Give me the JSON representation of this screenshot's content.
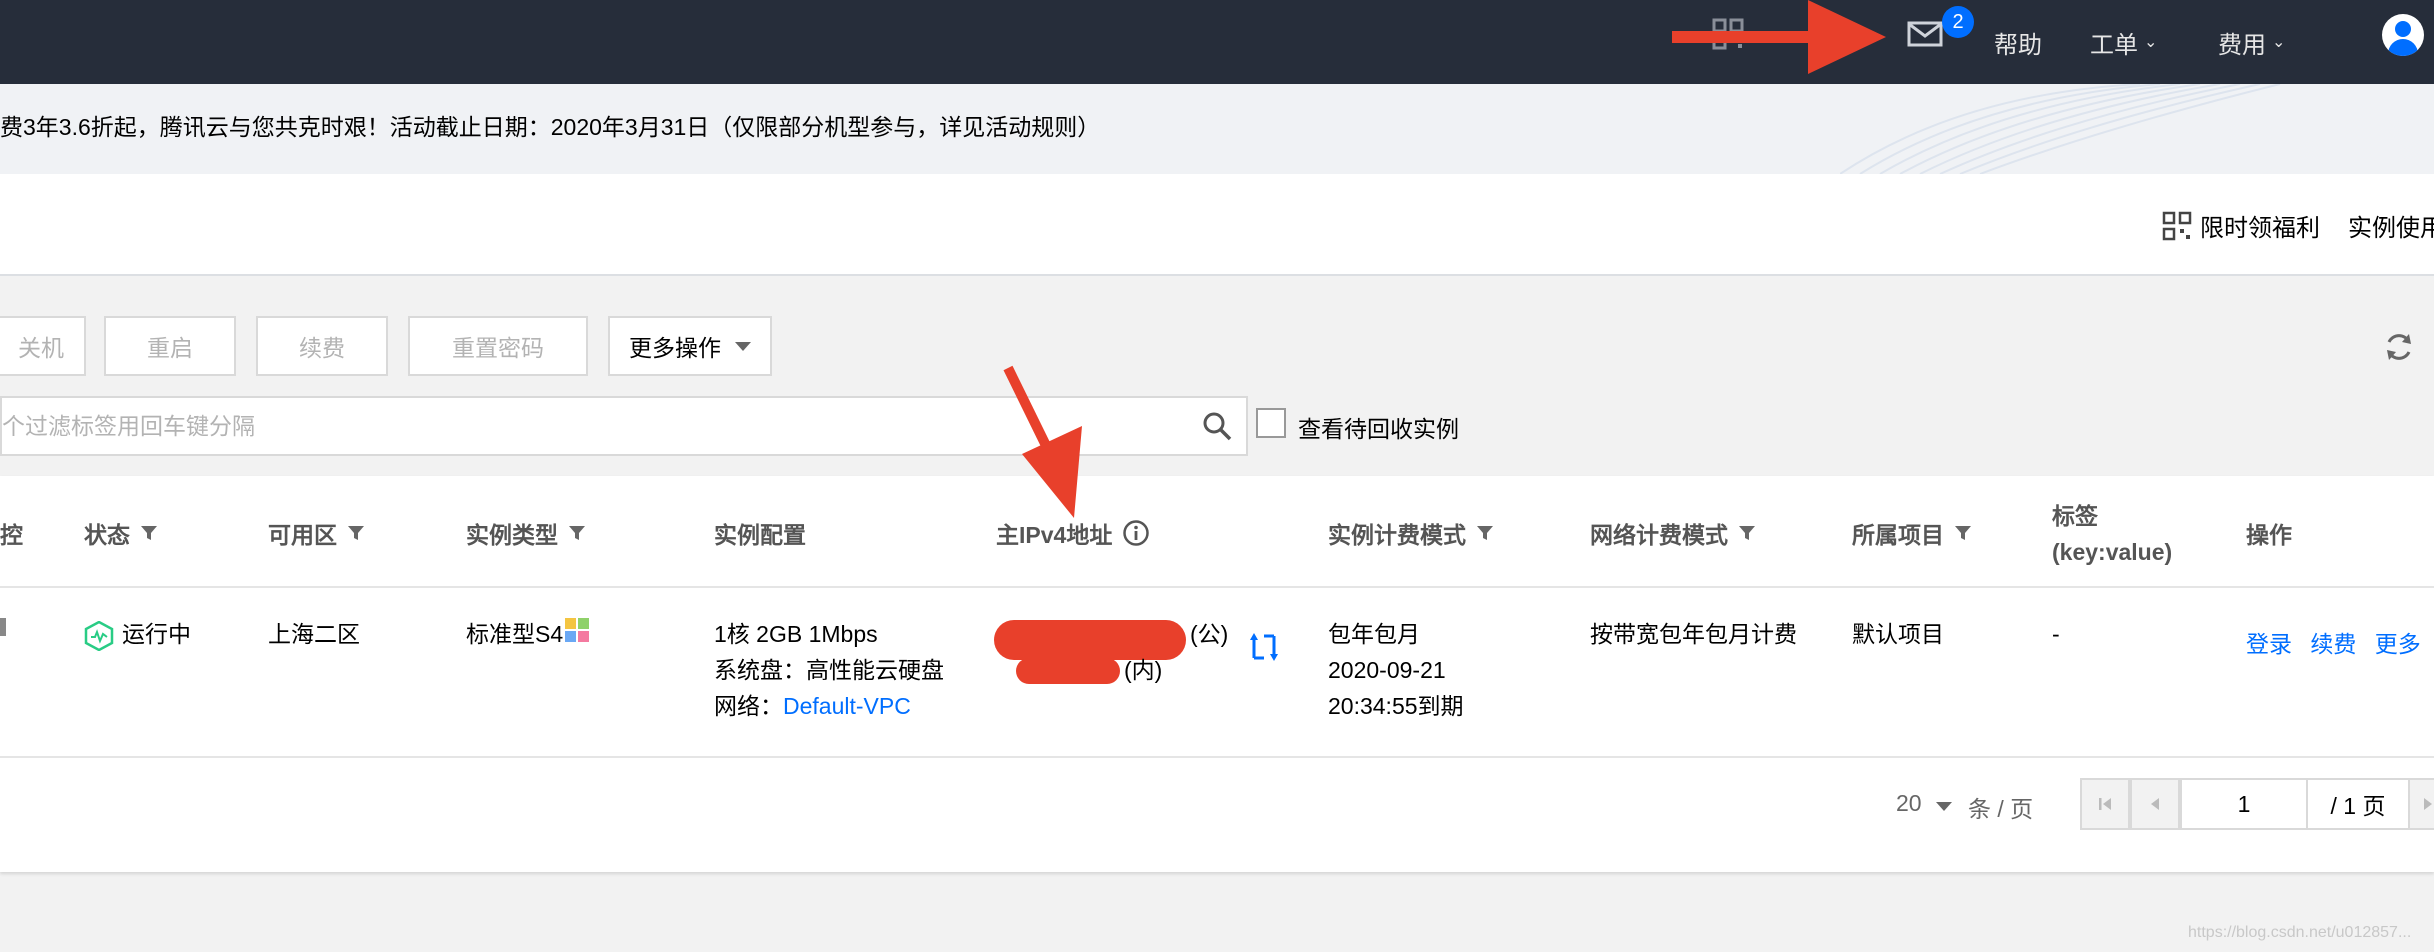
{
  "topbar": {
    "help_label": "帮助",
    "ticket_label": "工单",
    "fee_label": "费用",
    "mail_badge": "2"
  },
  "banner": {
    "text": "费3年3.6折起，腾讯云与您共克时艰！活动截止日期：2020年3月31日（仅限部分机型参与，详见活动规则）"
  },
  "header": {
    "benefit_label": "限时领福利",
    "usage_label": "实例使用"
  },
  "toolbar": {
    "shutdown_label": "关机",
    "restart_label": "重启",
    "renew_label": "续费",
    "reset_password_label": "重置密码",
    "more_actions_label": "更多操作",
    "search_placeholder": "个过滤标签用回车键分隔",
    "recycle_label": "查看待回收实例"
  },
  "table": {
    "columns": {
      "monitor": "控",
      "status": "状态",
      "zone": "可用区",
      "instance_type": "实例类型",
      "config": "实例配置",
      "ipv4": "主IPv4地址",
      "billing": "实例计费模式",
      "net_billing": "网络计费模式",
      "project": "所属项目",
      "tag_line1": "标签",
      "tag_line2": "(key:value)",
      "actions": "操作"
    },
    "rows": [
      {
        "status": "运行中",
        "zone": "上海二区",
        "instance_type": "标准型S4",
        "config_line1": "1核 2GB 1Mbps",
        "config_line2": "系统盘：高性能云硬盘",
        "config_line3_label": "网络：",
        "config_line3_link": "Default-VPC",
        "ip_public_suffix": "(公)",
        "ip_private_suffix": "(内)",
        "billing_line1": "包年包月",
        "billing_line2": "2020-09-21",
        "billing_line3": "20:34:55到期",
        "net_billing": "按带宽包年包月计费",
        "project": "默认项目",
        "tag": "-",
        "action_login": "登录",
        "action_renew": "续费",
        "action_more": "更多"
      }
    ]
  },
  "pagination": {
    "page_size": "20",
    "per_page_label": "条 / 页",
    "current_page": "1",
    "total_pages_label": "/ 1 页"
  },
  "watermark": "https://blog.csdn.net/u012857..."
}
